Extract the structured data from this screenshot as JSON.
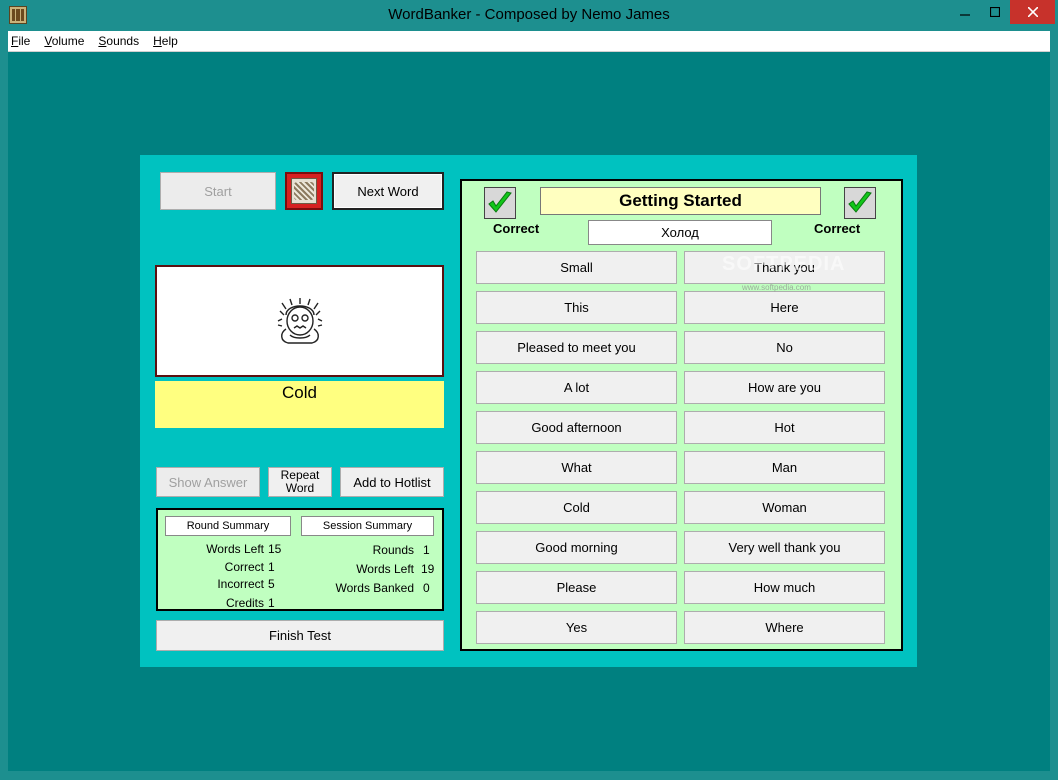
{
  "window": {
    "title": "WordBanker - Composed by Nemo James",
    "min_icon": "minimize-icon",
    "max_icon": "maximize-icon",
    "close_icon": "close-icon"
  },
  "menu": {
    "items": [
      {
        "label": "File",
        "accel": "F",
        "rest": "ile"
      },
      {
        "label": "Volume",
        "accel": "V",
        "rest": "olume"
      },
      {
        "label": "Sounds",
        "accel": "S",
        "rest": "ounds"
      },
      {
        "label": "Help",
        "accel": "H",
        "rest": "elp"
      }
    ]
  },
  "controls": {
    "start_label": "Start",
    "next_word_label": "Next Word",
    "show_answer_label": "Show Answer",
    "repeat_word_line1": "Repeat",
    "repeat_word_line2": "Word",
    "add_hotlist_label": "Add to  Hotlist",
    "finish_test_label": "Finish Test"
  },
  "current": {
    "word": "Cold",
    "translation": "Холод",
    "image_icon": "cold-person-icon"
  },
  "round_summary": {
    "title": "Round Summary",
    "rows": [
      {
        "label": "Words Left",
        "value": "15"
      },
      {
        "label": "Correct",
        "value": "1"
      },
      {
        "label": "Incorrect",
        "value": "5"
      },
      {
        "label": "Credits",
        "value": "1"
      }
    ]
  },
  "session_summary": {
    "title": "Session Summary",
    "rows": [
      {
        "label": "Rounds",
        "value": "1"
      },
      {
        "label": "Words Left",
        "value": "19"
      },
      {
        "label": "Words Banked",
        "value": "0"
      }
    ]
  },
  "quiz": {
    "topic": "Getting Started",
    "left_status": "Correct",
    "right_status": "Correct",
    "left_choices": [
      "Small",
      "This",
      "Pleased to meet you",
      "A lot",
      "Good afternoon",
      "What",
      "Cold",
      "Good morning",
      "Please",
      "Yes"
    ],
    "right_choices": [
      "Thank you",
      "Here",
      "No",
      "How are you",
      "Hot",
      "Man",
      "Woman",
      "Very well thank you",
      "How much",
      "Where"
    ]
  },
  "watermark": {
    "text": "SOFTPEDIA",
    "sub": "www.softpedia.com"
  },
  "colors": {
    "client_bg": "#008080",
    "panel_bg": "#00c2c0",
    "quiz_bg": "#c0ffc0",
    "word_bg": "#ffff80"
  }
}
